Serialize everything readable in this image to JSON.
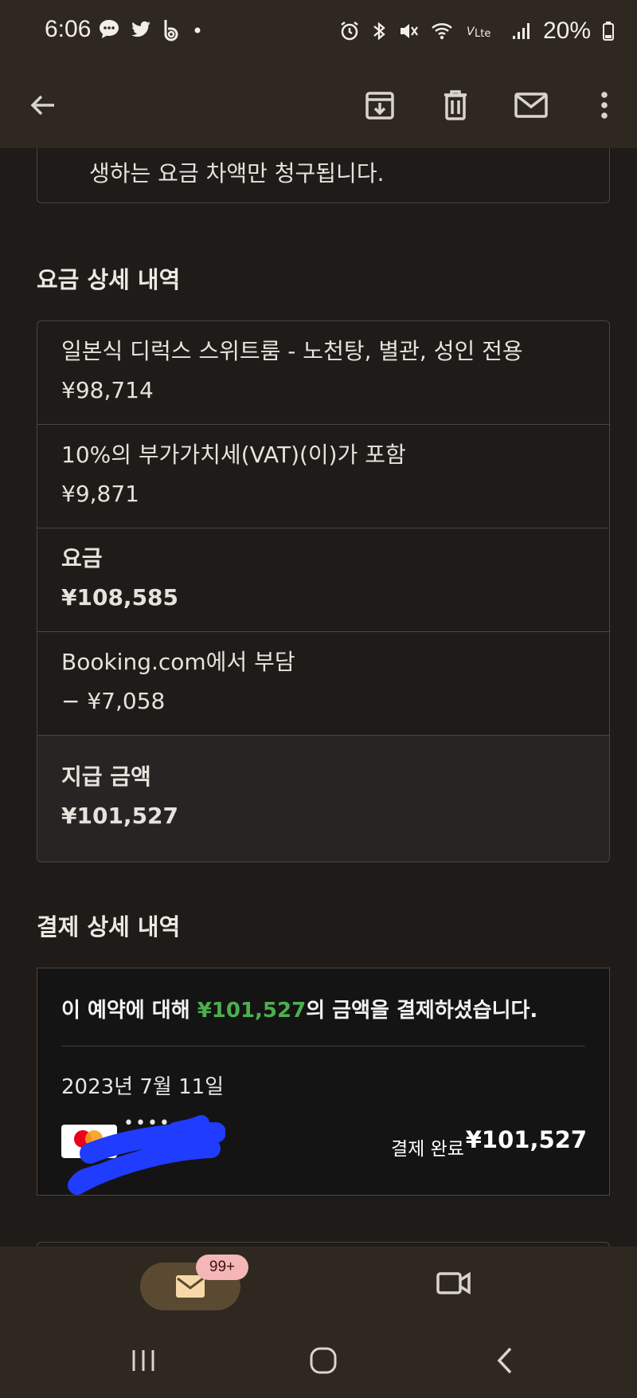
{
  "status_bar": {
    "time": "6:06",
    "battery_percent": "20%",
    "left_icons": [
      "chat-bubble-icon",
      "twitter-icon",
      "b-app-icon",
      "dot-icon"
    ],
    "right_icons": [
      "alarm-icon",
      "bluetooth-icon",
      "mute-icon",
      "wifi-icon",
      "volte-icon",
      "signal-icon",
      "battery-icon"
    ]
  },
  "app_bar": {
    "icons": [
      "back-arrow-icon",
      "archive-icon",
      "delete-icon",
      "mail-icon",
      "more-vert-icon"
    ]
  },
  "notice": {
    "text": "생하는 요금 차액만 청구됩니다."
  },
  "price_section": {
    "title": "요금 상세 내역",
    "rows": [
      {
        "label": "일본식 디럭스 스위트룸 - 노천탕, 별관, 성인 전용",
        "amount": "¥98,714"
      },
      {
        "label": "10%의 부가가치세(VAT)(이)가 포함",
        "amount": "¥9,871"
      },
      {
        "label": "요금",
        "amount": "¥108,585"
      },
      {
        "label": "Booking.com에서 부담",
        "amount": "− ¥7,058"
      },
      {
        "label": "지급 금액",
        "amount": "¥101,527"
      }
    ]
  },
  "payment_section": {
    "title": "결제 상세 내역",
    "message_prefix": "이 예약에 대해 ",
    "message_amount": "¥101,527",
    "message_suffix": "의 금액을 결제하셨습니다.",
    "date": "2023년 7월 11일",
    "card_dots": "••••",
    "status": "결제 완료",
    "amount": "¥101,527",
    "accent_color": "#4caf50"
  },
  "bottom_nav": {
    "mail_badge": "99+"
  },
  "colors": {
    "background": "#1e1b18",
    "bar": "#2e2820",
    "pill": "#5a4a32",
    "badge": "#f4b6b6",
    "redaction": "#1f3cff"
  }
}
